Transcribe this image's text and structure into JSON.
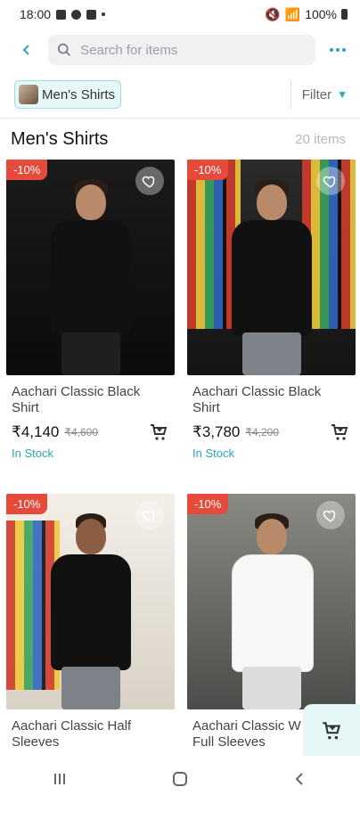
{
  "status_bar": {
    "time": "18:00",
    "battery": "100%"
  },
  "top_bar": {
    "search_placeholder": "Search for items"
  },
  "chip_bar": {
    "category_chip": "Men's Shirts",
    "filter_label": "Filter"
  },
  "header": {
    "title": "Men's Shirts",
    "count": "20 items"
  },
  "colors": {
    "accent": "#2aa7b5",
    "badge": "#e64a3b",
    "chip_bg": "#e6f7f8"
  },
  "products": [
    {
      "badge": "-10%",
      "name": "Aachari Classic Black Shirt",
      "price": "₹4,140",
      "mrp": "₹4,600",
      "stock": "In Stock",
      "icon_wishlist": "heart-icon",
      "icon_cart": "add-to-cart-icon"
    },
    {
      "badge": "-10%",
      "name": "Aachari Classic Black Shirt",
      "price": "₹3,780",
      "mrp": "₹4,200",
      "stock": "In Stock",
      "icon_wishlist": "heart-icon",
      "icon_cart": "add-to-cart-icon"
    },
    {
      "badge": "-10%",
      "name": "Aachari Classic Half Sleeves",
      "icon_wishlist": "heart-icon"
    },
    {
      "badge": "-10%",
      "name": "Aachari Classic W Ivory Full Sleeves",
      "icon_wishlist": "heart-icon"
    }
  ],
  "navbar": {
    "items": [
      "recent-apps-icon",
      "home-icon",
      "back-icon"
    ]
  }
}
